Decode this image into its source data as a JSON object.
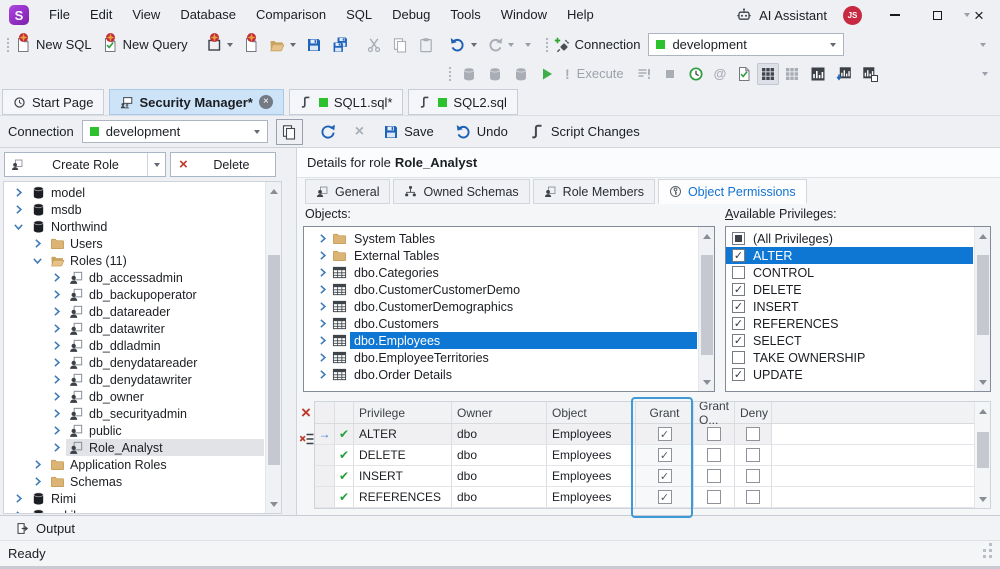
{
  "titlebar": {
    "logo_letter": "S",
    "menus": [
      "File",
      "Edit",
      "View",
      "Database",
      "Comparison",
      "SQL",
      "Debug",
      "Tools",
      "Window",
      "Help"
    ],
    "ai_assistant_label": "AI Assistant",
    "user_badge": "JS"
  },
  "toolbars": {
    "standard": {
      "new_sql_label": "New SQL",
      "new_query_label": "New Query",
      "connection_label": "Connection",
      "connection_value": "development"
    },
    "execute": {
      "execute_label": "Execute"
    }
  },
  "document_tabs": [
    {
      "label": "Start Page",
      "icon": "start-page-icon",
      "active": false
    },
    {
      "label": "Security Manager*",
      "icon": "security-manager-icon",
      "active": true,
      "closable": true
    },
    {
      "label": "SQL1.sql*",
      "icon": "sql-file-icon",
      "connection_dot": true
    },
    {
      "label": "SQL2.sql",
      "icon": "sql-file-icon",
      "connection_dot": true
    }
  ],
  "connection_bar": {
    "label": "Connection",
    "value": "development",
    "save_label": "Save",
    "undo_label": "Undo",
    "script_changes_label": "Script Changes"
  },
  "security_manager": {
    "create_role_label": "Create Role",
    "delete_label": "Delete",
    "tree": [
      {
        "label": "model",
        "level": 1,
        "icon": "database",
        "state": "collapsed"
      },
      {
        "label": "msdb",
        "level": 1,
        "icon": "database",
        "state": "collapsed"
      },
      {
        "label": "Northwind",
        "level": 1,
        "icon": "database",
        "state": "expanded"
      },
      {
        "label": "Users",
        "level": 2,
        "icon": "folder",
        "state": "collapsed"
      },
      {
        "label": "Roles (11)",
        "level": 2,
        "icon": "folder-open",
        "state": "expanded"
      },
      {
        "label": "db_accessadmin",
        "level": 3,
        "icon": "role",
        "state": "collapsed"
      },
      {
        "label": "db_backupoperator",
        "level": 3,
        "icon": "role",
        "state": "collapsed"
      },
      {
        "label": "db_datareader",
        "level": 3,
        "icon": "role",
        "state": "collapsed"
      },
      {
        "label": "db_datawriter",
        "level": 3,
        "icon": "role",
        "state": "collapsed"
      },
      {
        "label": "db_ddladmin",
        "level": 3,
        "icon": "role",
        "state": "collapsed"
      },
      {
        "label": "db_denydatareader",
        "level": 3,
        "icon": "role",
        "state": "collapsed"
      },
      {
        "label": "db_denydatawriter",
        "level": 3,
        "icon": "role",
        "state": "collapsed"
      },
      {
        "label": "db_owner",
        "level": 3,
        "icon": "role",
        "state": "collapsed"
      },
      {
        "label": "db_securityadmin",
        "level": 3,
        "icon": "role",
        "state": "collapsed"
      },
      {
        "label": "public",
        "level": 3,
        "icon": "role",
        "state": "collapsed"
      },
      {
        "label": "Role_Analyst",
        "level": 3,
        "icon": "role",
        "state": "collapsed",
        "selected": true
      },
      {
        "label": "Application Roles",
        "level": 2,
        "icon": "folder",
        "state": "collapsed"
      },
      {
        "label": "Schemas",
        "level": 2,
        "icon": "folder",
        "state": "collapsed"
      },
      {
        "label": "Rimi",
        "level": 1,
        "icon": "database",
        "state": "collapsed"
      },
      {
        "label": "sakila",
        "level": 1,
        "icon": "database",
        "state": "collapsed"
      }
    ]
  },
  "details": {
    "title_prefix": "Details for role",
    "role_name": "Role_Analyst",
    "tabs": [
      {
        "label": "General",
        "icon": "person-icon"
      },
      {
        "label": "Owned Schemas",
        "icon": "schema-icon"
      },
      {
        "label": "Role Members",
        "icon": "person-icon"
      },
      {
        "label": "Object Permissions",
        "icon": "permissions-icon",
        "active": true
      }
    ],
    "objects_label": "Objects:",
    "objects": [
      {
        "label": "System Tables",
        "icon": "folder"
      },
      {
        "label": "External Tables",
        "icon": "folder"
      },
      {
        "label": "dbo.Categories",
        "icon": "table"
      },
      {
        "label": "dbo.CustomerCustomerDemo",
        "icon": "table"
      },
      {
        "label": "dbo.CustomerDemographics",
        "icon": "table"
      },
      {
        "label": "dbo.Customers",
        "icon": "table"
      },
      {
        "label": "dbo.Employees",
        "icon": "table",
        "selected": true
      },
      {
        "label": "dbo.EmployeeTerritories",
        "icon": "table"
      },
      {
        "label": "dbo.Order Details",
        "icon": "table"
      }
    ],
    "privileges_label": "Available Privileges:",
    "privileges": [
      {
        "label": "(All Privileges)",
        "state": "mixed"
      },
      {
        "label": "ALTER",
        "state": "checked",
        "selected": true
      },
      {
        "label": "CONTROL",
        "state": "unchecked"
      },
      {
        "label": "DELETE",
        "state": "checked"
      },
      {
        "label": "INSERT",
        "state": "checked"
      },
      {
        "label": "REFERENCES",
        "state": "checked"
      },
      {
        "label": "SELECT",
        "state": "checked"
      },
      {
        "label": "TAKE OWNERSHIP",
        "state": "unchecked"
      },
      {
        "label": "UPDATE",
        "state": "checked"
      }
    ],
    "permissions_grid": {
      "columns": [
        "Privilege",
        "Owner",
        "Object",
        "Grant",
        "Grant O...",
        "Deny"
      ],
      "rows": [
        {
          "privilege": "ALTER",
          "owner": "dbo",
          "object": "Employees",
          "grant": true,
          "grant_option": false,
          "deny": false,
          "current": true
        },
        {
          "privilege": "DELETE",
          "owner": "dbo",
          "object": "Employees",
          "grant": true,
          "grant_option": false,
          "deny": false
        },
        {
          "privilege": "INSERT",
          "owner": "dbo",
          "object": "Employees",
          "grant": true,
          "grant_option": false,
          "deny": false
        },
        {
          "privilege": "REFERENCES",
          "owner": "dbo",
          "object": "Employees",
          "grant": true,
          "grant_option": false,
          "deny": false
        }
      ]
    }
  },
  "output_panel": {
    "label": "Output"
  },
  "status_bar": {
    "text": "Ready"
  },
  "colors": {
    "selection_blue": "#0e77d4",
    "active_tab_blue": "#cde4f8",
    "connection_green": "#2ec12e",
    "delete_red": "#c0392b",
    "grant_focus_border": "#3e9ad6",
    "logo_purple": "#8f2bbf"
  }
}
